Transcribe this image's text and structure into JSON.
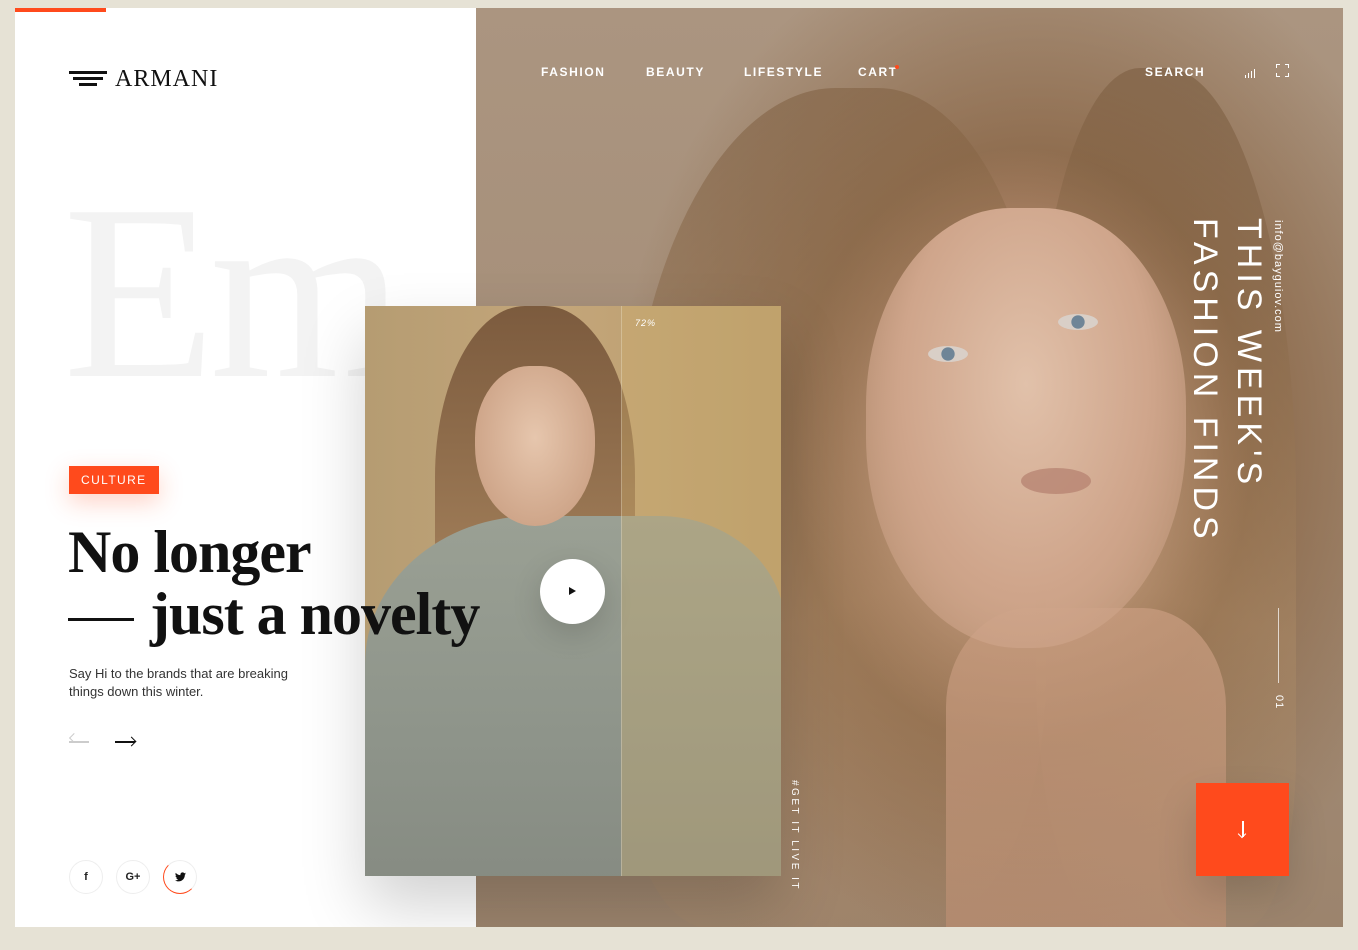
{
  "brand": {
    "name": "ARMANI"
  },
  "nav": {
    "items": [
      {
        "label": "FASHION"
      },
      {
        "label": "BEAUTY"
      },
      {
        "label": "LIFESTYLE"
      },
      {
        "label": "CART"
      }
    ],
    "search_label": "SEARCH"
  },
  "hero": {
    "background_word": "Em",
    "tag": "CULTURE",
    "headline_line1": "No longer",
    "headline_line2": "just a novelty",
    "subtext": "Say Hi to the brands that are breaking things down this winter.",
    "section_title_line1": "THIS WEEK'S",
    "section_title_line2": "FASHION FINDS",
    "email": "info@bayguiov.com",
    "page_number": "01"
  },
  "card": {
    "progress_label": "72%",
    "vertical_caption": "#GET IT LIVE IT"
  },
  "social": {
    "items": [
      {
        "label": "f",
        "icon": "facebook-icon"
      },
      {
        "label": "G+",
        "icon": "google-plus-icon"
      },
      {
        "label": "✔",
        "icon": "twitter-icon"
      }
    ]
  },
  "colors": {
    "accent": "#ff4a1c",
    "page_bg": "#e6e2d5",
    "text": "#111111"
  }
}
